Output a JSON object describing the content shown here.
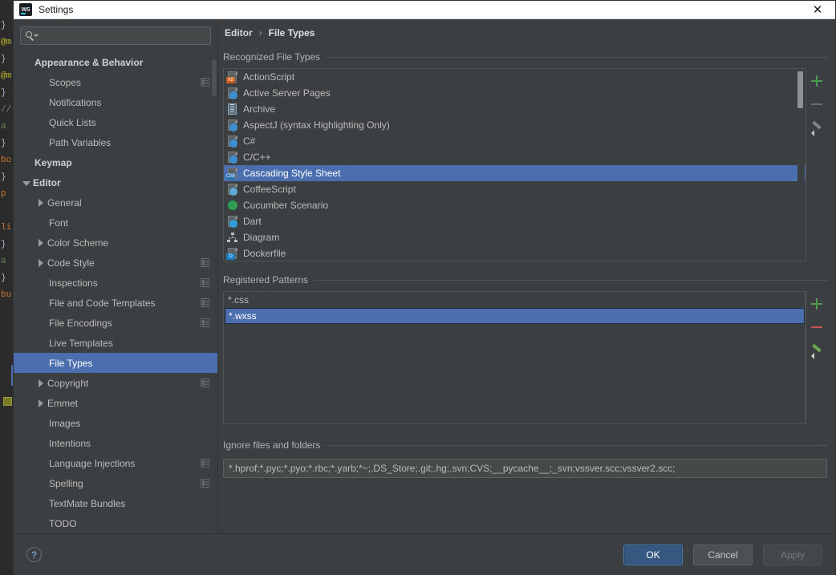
{
  "window": {
    "title": "Settings",
    "app_icon": "webstorm-icon",
    "close_label": "✕"
  },
  "search": {
    "value": "",
    "placeholder": ""
  },
  "sidebar": {
    "items": [
      {
        "label": "Appearance & Behavior",
        "level": 0,
        "bold": true,
        "arrow": "none",
        "cfg": false,
        "selected": false
      },
      {
        "label": "Scopes",
        "level": 1,
        "bold": false,
        "arrow": "none",
        "cfg": true,
        "selected": false
      },
      {
        "label": "Notifications",
        "level": 1,
        "bold": false,
        "arrow": "none",
        "cfg": false,
        "selected": false
      },
      {
        "label": "Quick Lists",
        "level": 1,
        "bold": false,
        "arrow": "none",
        "cfg": false,
        "selected": false
      },
      {
        "label": "Path Variables",
        "level": 1,
        "bold": false,
        "arrow": "none",
        "cfg": false,
        "selected": false
      },
      {
        "label": "Keymap",
        "level": 0,
        "bold": true,
        "arrow": "none",
        "cfg": false,
        "selected": false
      },
      {
        "label": "Editor",
        "level": 0,
        "bold": true,
        "arrow": "down",
        "cfg": false,
        "selected": false
      },
      {
        "label": "General",
        "level": 1,
        "bold": false,
        "arrow": "right",
        "cfg": false,
        "selected": false
      },
      {
        "label": "Font",
        "level": 1,
        "bold": false,
        "arrow": "none",
        "cfg": false,
        "selected": false
      },
      {
        "label": "Color Scheme",
        "level": 1,
        "bold": false,
        "arrow": "right",
        "cfg": false,
        "selected": false
      },
      {
        "label": "Code Style",
        "level": 1,
        "bold": false,
        "arrow": "right",
        "cfg": true,
        "selected": false
      },
      {
        "label": "Inspections",
        "level": 1,
        "bold": false,
        "arrow": "none",
        "cfg": true,
        "selected": false
      },
      {
        "label": "File and Code Templates",
        "level": 1,
        "bold": false,
        "arrow": "none",
        "cfg": true,
        "selected": false
      },
      {
        "label": "File Encodings",
        "level": 1,
        "bold": false,
        "arrow": "none",
        "cfg": true,
        "selected": false
      },
      {
        "label": "Live Templates",
        "level": 1,
        "bold": false,
        "arrow": "none",
        "cfg": false,
        "selected": false
      },
      {
        "label": "File Types",
        "level": 1,
        "bold": false,
        "arrow": "none",
        "cfg": false,
        "selected": true
      },
      {
        "label": "Copyright",
        "level": 1,
        "bold": false,
        "arrow": "right",
        "cfg": true,
        "selected": false
      },
      {
        "label": "Emmet",
        "level": 1,
        "bold": false,
        "arrow": "right",
        "cfg": false,
        "selected": false
      },
      {
        "label": "Images",
        "level": 1,
        "bold": false,
        "arrow": "none",
        "cfg": false,
        "selected": false
      },
      {
        "label": "Intentions",
        "level": 1,
        "bold": false,
        "arrow": "none",
        "cfg": false,
        "selected": false
      },
      {
        "label": "Language Injections",
        "level": 1,
        "bold": false,
        "arrow": "none",
        "cfg": true,
        "selected": false
      },
      {
        "label": "Spelling",
        "level": 1,
        "bold": false,
        "arrow": "none",
        "cfg": true,
        "selected": false
      },
      {
        "label": "TextMate Bundles",
        "level": 1,
        "bold": false,
        "arrow": "none",
        "cfg": false,
        "selected": false
      },
      {
        "label": "TODO",
        "level": 1,
        "bold": false,
        "arrow": "none",
        "cfg": false,
        "selected": false
      }
    ]
  },
  "breadcrumb": {
    "parent": "Editor",
    "separator": "›",
    "current": "File Types"
  },
  "recognized": {
    "group_label": "Recognized File Types",
    "items": [
      {
        "label": "ActionScript",
        "icon": "actionscript-file-icon",
        "selected": false
      },
      {
        "label": "Active Server Pages",
        "icon": "asp-file-icon",
        "selected": false
      },
      {
        "label": "Archive",
        "icon": "archive-file-icon",
        "selected": false
      },
      {
        "label": "AspectJ (syntax Highlighting Only)",
        "icon": "aspectj-file-icon",
        "selected": false
      },
      {
        "label": "C#",
        "icon": "csharp-file-icon",
        "selected": false
      },
      {
        "label": "C/C++",
        "icon": "cpp-file-icon",
        "selected": false
      },
      {
        "label": "Cascading Style Sheet",
        "icon": "css-file-icon",
        "selected": true
      },
      {
        "label": "CoffeeScript",
        "icon": "coffeescript-file-icon",
        "selected": false
      },
      {
        "label": "Cucumber Scenario",
        "icon": "cucumber-file-icon",
        "selected": false
      },
      {
        "label": "Dart",
        "icon": "dart-file-icon",
        "selected": false
      },
      {
        "label": "Diagram",
        "icon": "diagram-file-icon",
        "selected": false
      },
      {
        "label": "Dockerfile",
        "icon": "dockerfile-icon",
        "selected": false
      }
    ],
    "tools": {
      "add": "+",
      "remove": "−",
      "edit": "pencil"
    }
  },
  "patterns": {
    "group_label": "Registered Patterns",
    "items": [
      {
        "label": "*.css",
        "selected": false
      },
      {
        "label": "*.wxss",
        "selected": true
      }
    ],
    "tools": {
      "add": "+",
      "remove": "−",
      "edit": "pencil"
    }
  },
  "ignore": {
    "group_label": "Ignore files and folders",
    "value": "*.hprof;*.pyc;*.pyo;*.rbc;*.yarb;*~;.DS_Store;.git;.hg;.svn;CVS;__pycache__;_svn;vssver.scc;vssver2.scc;"
  },
  "footer": {
    "help_label": "?",
    "ok_label": "OK",
    "cancel_label": "Cancel",
    "apply_label": "Apply"
  },
  "colors": {
    "selection_blue": "#4b6eaf",
    "primary_button": "#365880",
    "panel_bg": "#3c3f41",
    "add_green": "#4e9a50",
    "remove_red": "#c75450"
  }
}
